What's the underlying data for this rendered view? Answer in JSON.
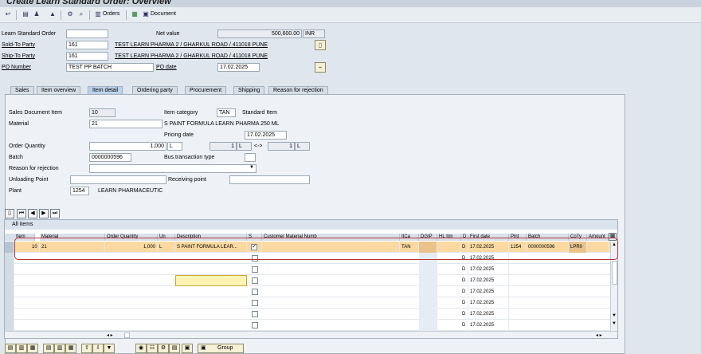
{
  "window": {
    "title": "Create Learn Standard Order: Overview"
  },
  "toolbar": {
    "orders_label": "Orders",
    "document_label": "Document"
  },
  "header": {
    "order_type_label": "Learn Standard Order",
    "order_number": "",
    "net_value_label": "Net value",
    "net_value": "500,600.00",
    "currency": "INR",
    "sold_to_label": "Sold-To Party",
    "sold_to_value": "161",
    "sold_to_desc": "TEST LEARN PHARMA 2 / GHARKUL ROAD / 411018 PUNE",
    "ship_to_label": "Ship-To Party",
    "ship_to_value": "161",
    "ship_to_desc": "TEST LEARN PHARMA 2 / GHARKUL ROAD / 411018 PUNE",
    "po_number_label": "PO Number",
    "po_number": "TEST PP BATCH",
    "po_date_label": "PO date",
    "po_date": "17.02.2025"
  },
  "tabs": [
    {
      "label": "Sales"
    },
    {
      "label": "Item overview"
    },
    {
      "label": "Item detail"
    },
    {
      "label": "Ordering party"
    },
    {
      "label": "Procurement"
    },
    {
      "label": "Shipping"
    },
    {
      "label": "Reason for rejection"
    }
  ],
  "detail": {
    "sales_doc_item_label": "Sales Document Item",
    "sales_doc_item": "10",
    "item_category_label": "Item category",
    "item_category": "TAN",
    "item_category_desc": "Standard Item",
    "material_label": "Material",
    "material": "21",
    "material_desc": "S PAINT FORMULA LEARN PHARMA 250 ML",
    "pricing_date_label": "Pricing date",
    "pricing_date": "17.02.2025",
    "order_qty_label": "Order Quantity",
    "order_qty": "1,000",
    "uom": "L",
    "conv_qty1": "1",
    "conv_uom1": "L",
    "conv_arrow": "<->",
    "conv_qty2": "1",
    "conv_uom2": "L",
    "batch_label": "Batch",
    "batch": "0000000596",
    "bus_trans_label": "Bus.transaction type",
    "bus_trans": "",
    "reason_rejection_label": "Reason for rejection",
    "reason_rejection": "",
    "unloading_label": "Unloading Point",
    "unloading": "",
    "receiving_label": "Receiving point",
    "receiving": "",
    "plant_label": "Plant",
    "plant": "1254",
    "plant_desc": "LEARN PHARMACEUTIC"
  },
  "items_table": {
    "title": "All items",
    "columns": [
      "Item",
      "Material",
      "Order Quantity",
      "Un",
      "Description",
      "S",
      "Customer Material Numb",
      "ItCa",
      "DGIP",
      "HL Itm",
      "D",
      "First date",
      "Plnt",
      "Batch",
      "CoTy",
      "Amount"
    ],
    "row1": {
      "item": "10",
      "material": "21",
      "qty": "1,000",
      "un": "L",
      "description": "S PAINT FORMULA LEAR...",
      "s_checked": "✓",
      "itca": "TAN",
      "d": "D",
      "first_date": "17.02.2025",
      "plnt": "1254",
      "batch": "0000000596",
      "coty": "LPR0"
    },
    "empty_rows": [
      {
        "d": "D",
        "date": "17.02.2025"
      },
      {
        "d": "D",
        "date": "17.02.2025"
      },
      {
        "d": "D",
        "date": "17.02.2025"
      },
      {
        "d": "D",
        "date": "17.02.2025"
      },
      {
        "d": "D",
        "date": "17.02.2025"
      },
      {
        "d": "D",
        "date": "17.02.2025"
      },
      {
        "d": "D",
        "date": "17.02.2025"
      }
    ]
  },
  "bottom": {
    "group_label": "Group"
  }
}
